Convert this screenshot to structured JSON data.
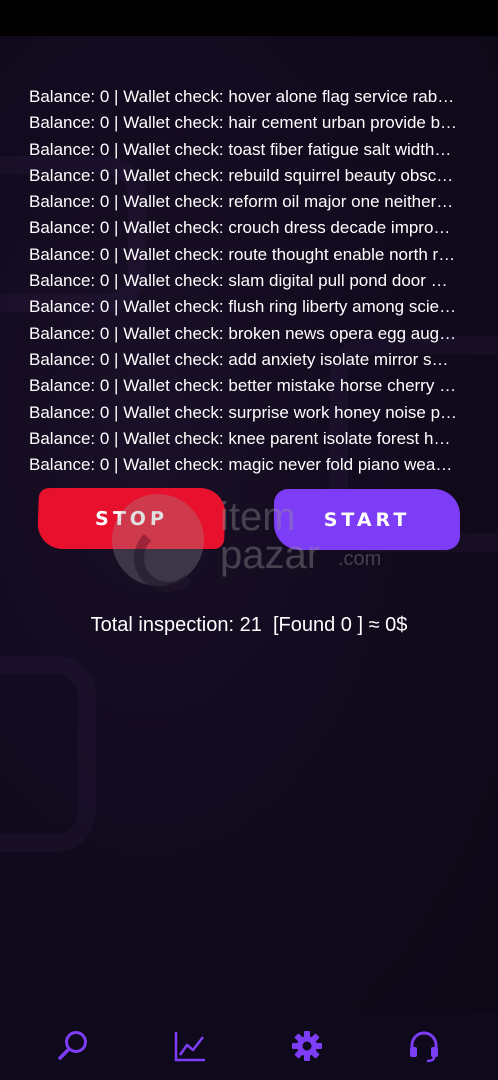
{
  "log": {
    "lines": [
      "Balance: 0 | Wallet check: hover alone flag service rab…",
      "Balance: 0 | Wallet check: hair cement urban provide b…",
      "Balance: 0 | Wallet check: toast fiber fatigue salt width…",
      "Balance: 0 | Wallet check: rebuild squirrel beauty obsc…",
      "Balance: 0 | Wallet check: reform oil major one neither…",
      "Balance: 0 | Wallet check: crouch dress decade impro…",
      "Balance: 0 | Wallet check: route thought enable north r…",
      "Balance: 0 | Wallet check: slam digital pull pond door …",
      "Balance: 0 | Wallet check: flush ring liberty among scie…",
      "Balance: 0 | Wallet check: broken news opera egg aug…",
      "Balance: 0 | Wallet check: add anxiety isolate mirror s…",
      "Balance: 0 | Wallet check: better mistake horse cherry …",
      "Balance: 0 | Wallet check: surprise work honey noise p…",
      "Balance: 0 | Wallet check: knee parent isolate forest h…",
      "Balance: 0 | Wallet check: magic never fold piano wea…"
    ]
  },
  "controls": {
    "stop_label": "STOP",
    "start_label": "START"
  },
  "watermark": {
    "line1": "item",
    "line2": "pazar",
    "suffix": ".com"
  },
  "summary": {
    "text": "Total inspection: 21  [Found 0 ] ≈ 0$"
  },
  "nav": {
    "items": [
      {
        "icon": "search-icon",
        "active": true
      },
      {
        "icon": "chart-icon",
        "active": false
      },
      {
        "icon": "gear-icon",
        "active": false
      },
      {
        "icon": "headset-icon",
        "active": false
      }
    ]
  },
  "colors": {
    "accent": "#7d3cf5",
    "stop": "#e8112d",
    "background": "#120a1e"
  }
}
